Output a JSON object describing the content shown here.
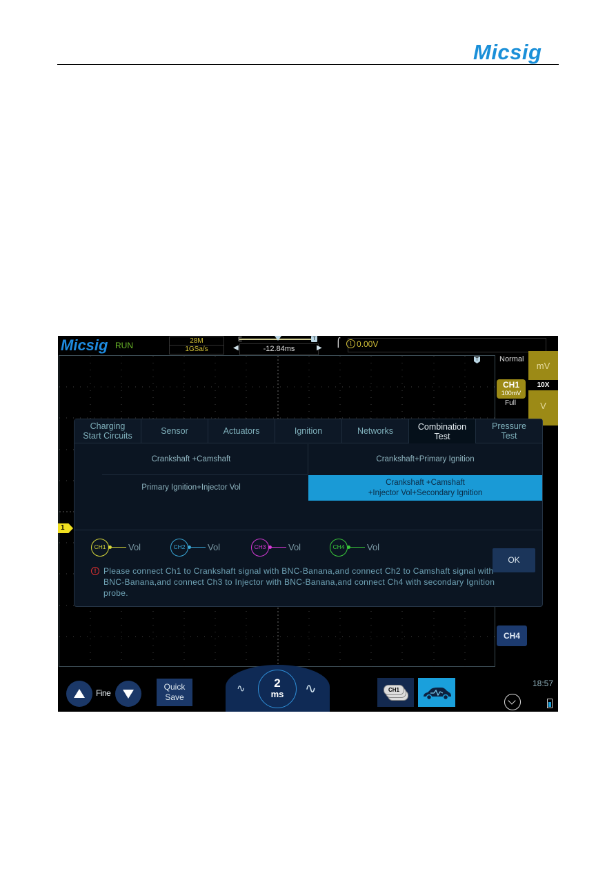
{
  "page": {
    "logo": "Micsig"
  },
  "topbar": {
    "brand": "Micsig",
    "run_status": "RUN",
    "memory_depth": "28M",
    "sample_rate": "1GSa/s",
    "timebase_edge_label": "E",
    "trigger_marker_label": "T",
    "horizontal_position": "-12.84ms",
    "trigger_source": "1",
    "trigger_level": "0.00V"
  },
  "right_panel": {
    "trigger_mode": "Normal",
    "channel_badge": "CH1",
    "channel_scale": "100mV",
    "bandwidth": "Full",
    "unit_up": "mV",
    "probe_ratio": "10X",
    "unit_down": "V",
    "ch4_button": "CH4"
  },
  "grid": {
    "ch1_marker": "1",
    "trigger_marker": "T"
  },
  "dialog": {
    "tabs": [
      {
        "label": "Charging\nStart Circuits",
        "active": false
      },
      {
        "label": "Sensor",
        "active": false
      },
      {
        "label": "Actuators",
        "active": false
      },
      {
        "label": "Ignition",
        "active": false
      },
      {
        "label": "Networks",
        "active": false
      },
      {
        "label": "Combination\nTest",
        "active": true
      },
      {
        "label": "Pressure\nTest",
        "active": false
      }
    ],
    "options": [
      {
        "label": "Crankshaft +Camshaft",
        "selected": false
      },
      {
        "label": "Crankshaft+Primary Ignition",
        "selected": false
      },
      {
        "label": "Primary Ignition+Injector Vol",
        "selected": false
      },
      {
        "label": "Crankshaft +Camshaft\n+Injector Vol+Secondary Ignition",
        "selected": true
      }
    ],
    "channels": [
      {
        "name": "CH1",
        "label": "Vol",
        "color": "#d8d83a"
      },
      {
        "name": "CH2",
        "label": "Vol",
        "color": "#3aa8d8"
      },
      {
        "name": "CH3",
        "label": "Vol",
        "color": "#d83ad8"
      },
      {
        "name": "CH4",
        "label": "Vol",
        "color": "#3ac83a"
      }
    ],
    "instruction": "Please connect Ch1 to Crankshaft signal with BNC-Banana,and connect Ch2 to Camshaft signal with BNC-Banana,and connect Ch3 to Injector with BNC-Banana,and connect Ch4 with secondary Ignition probe.",
    "warning_icon": "!",
    "ok_label": "OK"
  },
  "bottombar": {
    "fine_label": "Fine",
    "quick_save_label": "Quick\nSave",
    "timebase_value": "2",
    "timebase_unit": "ms",
    "ch1_stack_label": "CH1",
    "clock": "18:57"
  },
  "colors": {
    "accent": "#1aa0dc",
    "ch1": "#d8d83a",
    "brand": "#1a8fd8"
  }
}
